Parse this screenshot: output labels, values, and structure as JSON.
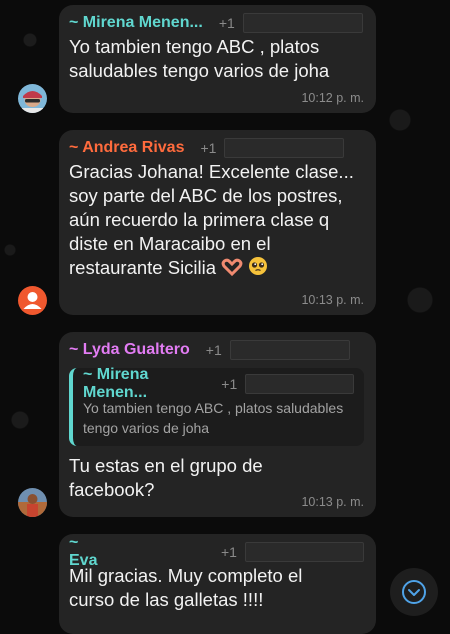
{
  "messages": [
    {
      "sender": "~ Mirena Menen...",
      "sender_color": "#60d7cf",
      "plus": "+1",
      "text": "Yo tambien tengo ABC , platos saludables tengo varios de joha",
      "time": "10:12 p. m."
    },
    {
      "sender": "~ Andrea Rivas",
      "sender_color": "#ff6b3d",
      "plus": "+1",
      "text": "Gracias Johana! Excelente clase... soy parte del ABC de los postres, aún recuerdo la primera clase q diste en Maracaibo en el restaurante Sicilia",
      "time": "10:13 p. m."
    },
    {
      "sender": "~ Lyda Gualtero",
      "sender_color": "#e27cf3",
      "plus": "+1",
      "quote": {
        "sender": "~ Mirena Menen...",
        "plus": "+1",
        "text": "Yo tambien tengo ABC , platos saludables tengo varios de joha"
      },
      "text": "Tu estas en el grupo de facebook?",
      "time": "10:13 p. m."
    },
    {
      "sender": "~ Eva",
      "sender_color": "#60d7cf",
      "plus": "+1",
      "text": "Mil gracias. Muy completo el curso de las galletas !!!!"
    }
  ],
  "icons": {
    "scroll_down": "chevron-down-icon",
    "emoji1": "heart-hands-emoji",
    "emoji2": "pleading-face-emoji"
  },
  "colors": {
    "bubble": "#242424",
    "background": "#0b0b0b",
    "accent": "#60d7cf"
  }
}
